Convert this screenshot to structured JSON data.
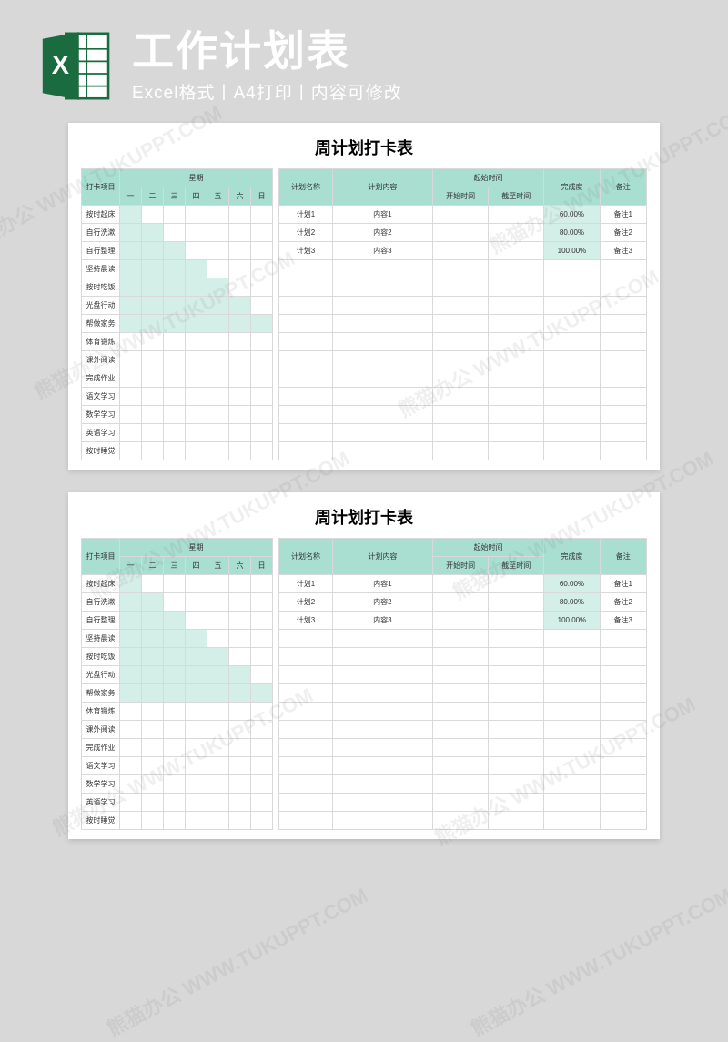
{
  "banner": {
    "title": "工作计划表",
    "subtitle": "Excel格式丨A4打印丨内容可修改"
  },
  "colors": {
    "header": "#a8dfd0",
    "shade": "#d4efe7"
  },
  "table": {
    "title": "周计划打卡表",
    "left": {
      "item_header": "打卡项目",
      "week_header": "星期",
      "days": [
        "一",
        "二",
        "三",
        "四",
        "五",
        "六",
        "日"
      ],
      "items": [
        {
          "label": "按时起床",
          "fill": 1
        },
        {
          "label": "自行洗漱",
          "fill": 2
        },
        {
          "label": "自行整理",
          "fill": 3
        },
        {
          "label": "坚持晨读",
          "fill": 4
        },
        {
          "label": "按时吃饭",
          "fill": 5
        },
        {
          "label": "光盘行动",
          "fill": 6
        },
        {
          "label": "帮做家务",
          "fill": 7
        },
        {
          "label": "体育锻炼",
          "fill": 0
        },
        {
          "label": "课外阅读",
          "fill": 0
        },
        {
          "label": "完成作业",
          "fill": 0
        },
        {
          "label": "语文学习",
          "fill": 0
        },
        {
          "label": "数学学习",
          "fill": 0
        },
        {
          "label": "英语学习",
          "fill": 0
        },
        {
          "label": "按时睡觉",
          "fill": 0
        }
      ]
    },
    "right": {
      "plan_name_header": "计划名称",
      "plan_content_header": "计划内容",
      "time_group_header": "起始时间",
      "start_header": "开始时间",
      "end_header": "截至时间",
      "pct_header": "完成度",
      "note_header": "备注",
      "rows": [
        {
          "name": "计划1",
          "content": "内容1",
          "start": "",
          "end": "",
          "pct": "60.00%",
          "note": "备注1"
        },
        {
          "name": "计划2",
          "content": "内容2",
          "start": "",
          "end": "",
          "pct": "80.00%",
          "note": "备注2"
        },
        {
          "name": "计划3",
          "content": "内容3",
          "start": "",
          "end": "",
          "pct": "100.00%",
          "note": "备注3"
        }
      ],
      "blank_rows": 11
    }
  },
  "watermark": "熊猫办公 WWW.TUKUPPT.COM"
}
